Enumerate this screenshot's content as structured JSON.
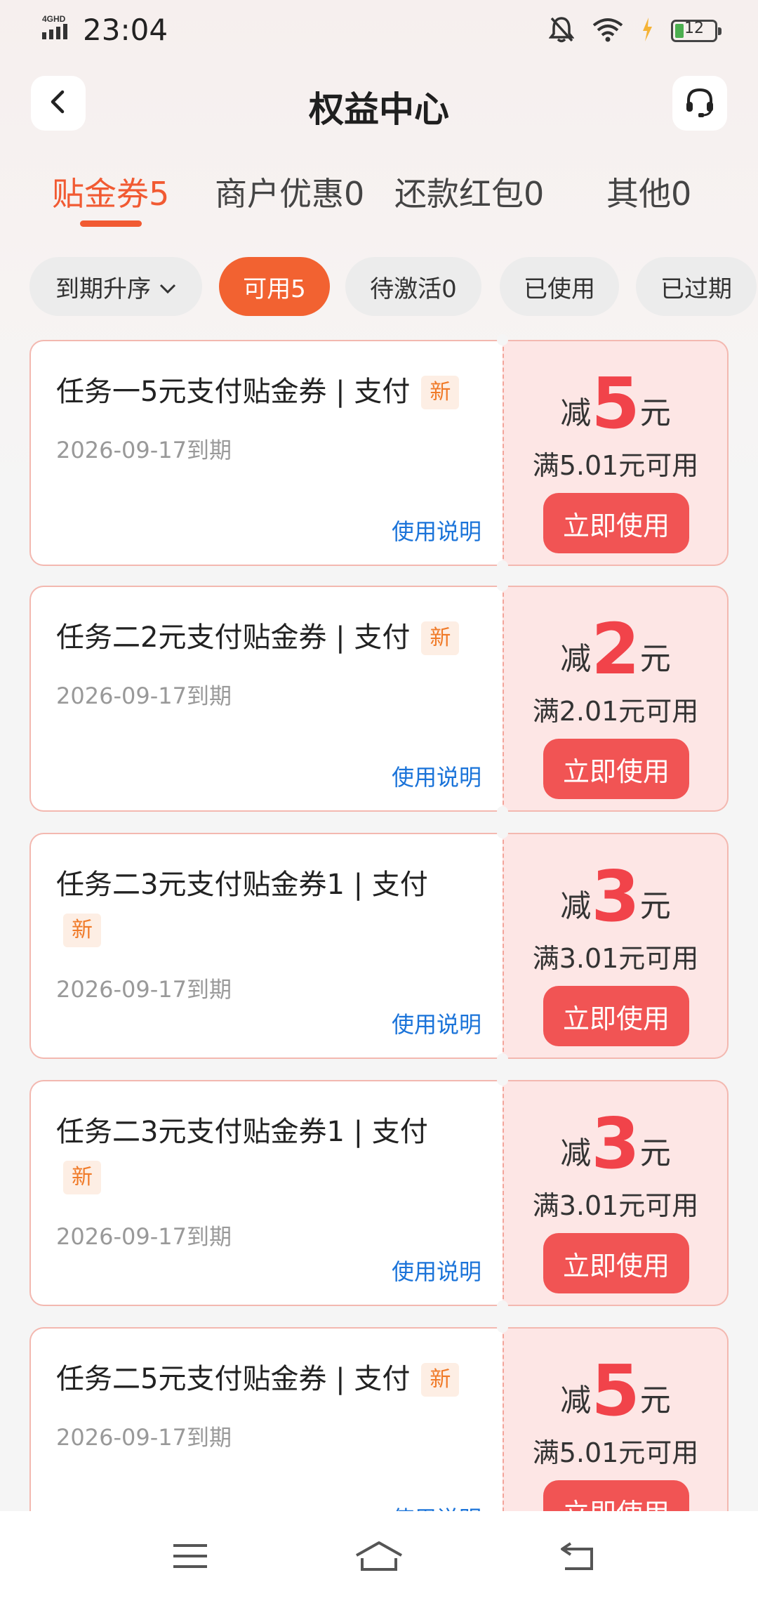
{
  "status_bar": {
    "network": "4GHD",
    "time": "23:04",
    "battery": "12"
  },
  "header": {
    "title": "权益中心"
  },
  "tabs": [
    {
      "label": "贴金券5",
      "active": true
    },
    {
      "label": "商户优惠0"
    },
    {
      "label": "还款红包0"
    },
    {
      "label": "其他0"
    }
  ],
  "filters": [
    {
      "label": "到期升序"
    },
    {
      "label": "可用5",
      "active": true
    },
    {
      "label": "待激活0"
    },
    {
      "label": "已使用"
    },
    {
      "label": "已过期"
    }
  ],
  "coupons": [
    {
      "title": "任务一5元支付贴金券 | 支付",
      "badge": "新",
      "expiry": "2026-09-17到期",
      "howto": "使用说明",
      "prefix": "减",
      "amount": "5",
      "unit": "元",
      "condition": "满5.01元可用",
      "button": "立即使用"
    },
    {
      "title": "任务二2元支付贴金券 | 支付",
      "badge": "新",
      "expiry": "2026-09-17到期",
      "howto": "使用说明",
      "prefix": "减",
      "amount": "2",
      "unit": "元",
      "condition": "满2.01元可用",
      "button": "立即使用"
    },
    {
      "title": "任务二3元支付贴金券1 | 支付",
      "badge": "新",
      "expiry": "2026-09-17到期",
      "howto": "使用说明",
      "prefix": "减",
      "amount": "3",
      "unit": "元",
      "condition": "满3.01元可用",
      "button": "立即使用"
    },
    {
      "title": "任务二3元支付贴金券1 | 支付",
      "badge": "新",
      "expiry": "2026-09-17到期",
      "howto": "使用说明",
      "prefix": "减",
      "amount": "3",
      "unit": "元",
      "condition": "满3.01元可用",
      "button": "立即使用"
    },
    {
      "title": "任务二5元支付贴金券 | 支付",
      "badge": "新",
      "expiry": "2026-09-17到期",
      "howto": "使用说明",
      "prefix": "减",
      "amount": "5",
      "unit": "元",
      "condition": "满5.01元可用",
      "button": "立即使用"
    }
  ],
  "icons": {
    "back": "chevron-left-icon",
    "service": "headset-icon",
    "sort": "chevron-down-icon",
    "nav": [
      "menu-icon",
      "home-icon",
      "back-arrow-icon"
    ]
  },
  "colors": {
    "accent": "#f15a32",
    "coupon_red": "#f1434a",
    "button_red": "#f15454",
    "link_blue": "#1a73d9"
  }
}
